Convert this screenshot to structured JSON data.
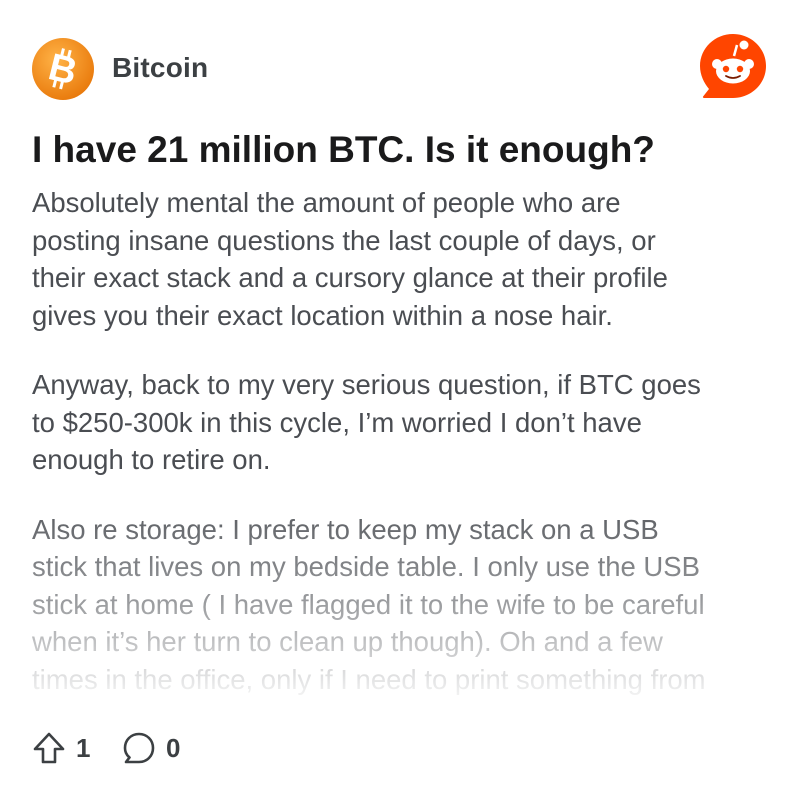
{
  "post": {
    "subreddit": "Bitcoin",
    "title": "I have 21 million BTC. Is it enough?",
    "paragraphs": [
      "Absolutely mental the amount of people who are\nposting insane questions the last couple of days, or\ntheir exact stack and a cursory glance at their profile\ngives you their exact location within a nose hair.",
      "Anyway, back to my very serious question, if BTC goes\nto $250-300k in this cycle, I’m worried I don’t have\nenough to retire on.",
      "Also re storage: I prefer to keep my stack on a USB\nstick that lives on my bedside table. I only use the USB\nstick at home ( I have flagged it to the wife to be careful\nwhen it’s her turn to clean up though). Oh and a few\ntimes in the office, only if I need to print something from"
    ],
    "upvotes": "1",
    "comments": "0"
  },
  "icons": {
    "subreddit_avatar": "bitcoin-logo-icon",
    "brand_logo": "reddit-snoo-icon",
    "upvote": "upvote-arrow-icon",
    "comment": "comment-bubble-icon"
  },
  "colors": {
    "bitcoin_orange": "#f7931a",
    "reddit_orange": "#ff4500",
    "title_text": "#1a1a1b",
    "body_text": "#4a4d52"
  }
}
